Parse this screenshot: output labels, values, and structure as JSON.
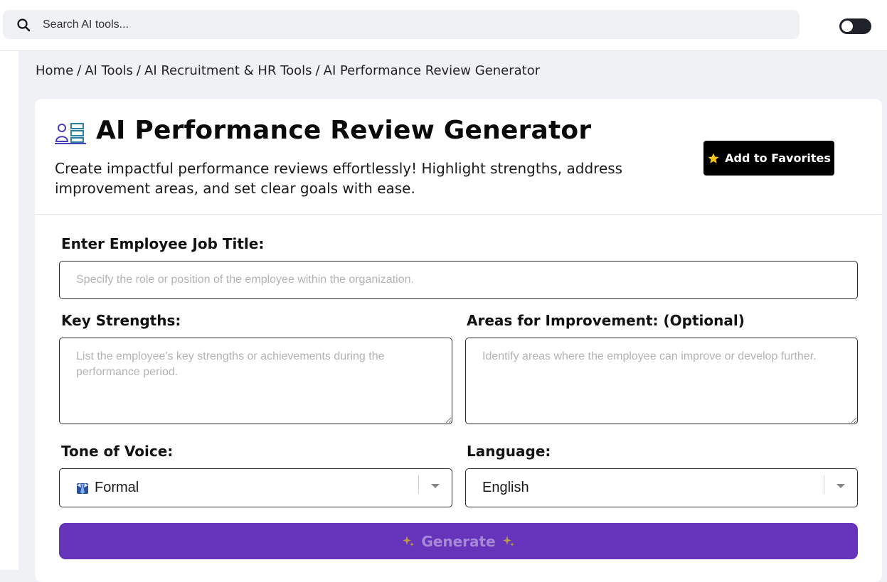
{
  "search": {
    "placeholder": "Search AI tools..."
  },
  "breadcrumb": {
    "items": [
      "Home",
      "AI Tools",
      "AI Recruitment & HR Tools",
      "AI Performance Review Generator"
    ],
    "separator": "/"
  },
  "tool": {
    "title": "AI Performance Review Generator",
    "description": "Create impactful performance reviews effortlessly! Highlight strengths, address improvement areas, and set clear goals with ease.",
    "favorite_label": "Add to Favorites"
  },
  "form": {
    "job_title": {
      "label": "Enter Employee Job Title:",
      "placeholder": "Specify the role or position of the employee within the organization."
    },
    "strengths": {
      "label": "Key Strengths:",
      "placeholder": "List the employee's key strengths or achievements during the performance period."
    },
    "improvement": {
      "label": "Areas for Improvement: (Optional)",
      "placeholder": "Identify areas where the employee can improve or develop further."
    },
    "tone": {
      "label": "Tone of Voice:",
      "value": "Formal"
    },
    "language": {
      "label": "Language:",
      "value": "English"
    },
    "generate_label": "Generate"
  },
  "colors": {
    "accent": "#6633bb",
    "button_dark": "#000000",
    "page_background": "#f0f1f5"
  },
  "icons": {
    "search": "search-icon",
    "toggle": "theme-toggle",
    "title": "employee-list-icon",
    "favorite": "star-icon",
    "tone": "necktie-icon",
    "generate": "sparkles-icon"
  }
}
